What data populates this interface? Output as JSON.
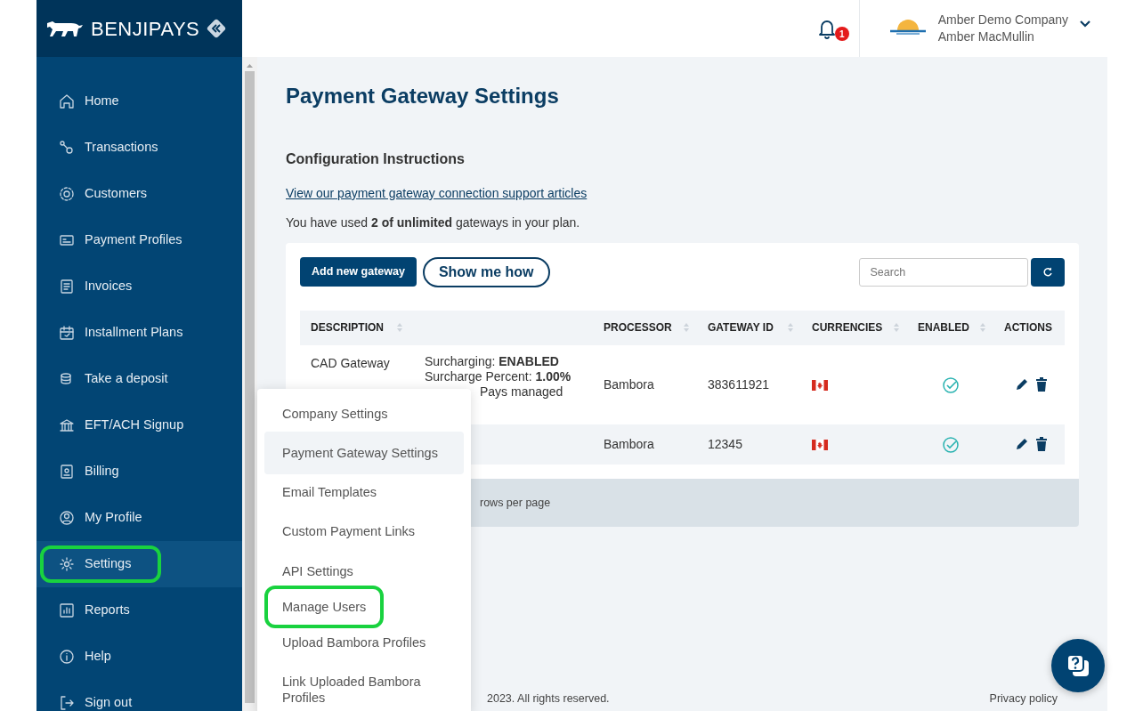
{
  "logo": {
    "text": "**BENJI**PAYS"
  },
  "sidebar": {
    "items": [
      {
        "label": "Home",
        "selected": false,
        "highlighted": false
      },
      {
        "label": "Transactions",
        "selected": false,
        "highlighted": false
      },
      {
        "label": "Customers",
        "selected": false,
        "highlighted": false
      },
      {
        "label": "Payment Profiles",
        "selected": false,
        "highlighted": false
      },
      {
        "label": "Invoices",
        "selected": false,
        "highlighted": false
      },
      {
        "label": "Installment Plans",
        "selected": false,
        "highlighted": false
      },
      {
        "label": "Take a deposit",
        "selected": false,
        "highlighted": false
      },
      {
        "label": "EFT/ACH Signup",
        "selected": false,
        "highlighted": false
      },
      {
        "label": "Billing",
        "selected": false,
        "highlighted": false
      },
      {
        "label": "My Profile",
        "selected": false,
        "highlighted": false
      },
      {
        "label": "Settings",
        "selected": true,
        "highlighted": true
      },
      {
        "label": "Reports",
        "selected": false,
        "highlighted": false
      },
      {
        "label": "Help",
        "selected": false,
        "highlighted": false
      },
      {
        "label": "Sign out",
        "selected": false,
        "highlighted": false
      }
    ]
  },
  "topbar": {
    "notifications": "1",
    "company": "Amber Demo Company",
    "user": "Amber MacMullin"
  },
  "page": {
    "title": "Payment Gateway Settings",
    "section": "Configuration Instructions",
    "link": "View our payment gateway connection support articles",
    "usage": "You have used **2 of unlimited** gateways in your plan."
  },
  "toolbar": {
    "buttons": [
      "Add new gateway",
      "Show me how"
    ],
    "search": {
      "placeholder": "Search"
    }
  },
  "table": {
    "columns": [
      {
        "label": "DESCRIPTION",
        "sortable": true
      },
      {
        "label": "PROCESSOR",
        "sortable": true
      },
      {
        "label": "GATEWAY ID",
        "sortable": true
      },
      {
        "label": "CURRENCIES",
        "sortable": true
      },
      {
        "label": "ENABLED",
        "sortable": true
      },
      {
        "label": "ACTIONS",
        "sortable": false
      }
    ],
    "rows": [
      {
        "description": "CAD Gateway",
        "details": [
          {
            "text": "Surcharging: **ENABLED**",
            "covered": false
          },
          {
            "text": "Surcharge Percent: **1.00%**",
            "covered": false
          },
          {
            "text": "Pays managed",
            "covered": true
          }
        ],
        "processor": "Bambora",
        "gateway_id": "383611921",
        "enabled": true
      },
      {
        "processor": "Bambora",
        "gateway_id": "12345",
        "enabled": true
      }
    ]
  },
  "pagination": {
    "label": "rows per page"
  },
  "dropdown": {
    "items": [
      {
        "label": "Company Settings",
        "selected": false,
        "highlighted": false
      },
      {
        "label": "Payment Gateway Settings",
        "selected": true,
        "highlighted": false
      },
      {
        "label": "Email Templates",
        "selected": false,
        "highlighted": false
      },
      {
        "label": "Custom Payment Links",
        "selected": false,
        "highlighted": false
      },
      {
        "label": "API Settings",
        "selected": false,
        "highlighted": false
      },
      {
        "label": "Manage Users",
        "selected": false,
        "highlighted": true
      },
      {
        "label": "Upload Bambora Profiles",
        "selected": false,
        "highlighted": false
      },
      {
        "label": "Link Uploaded Bambora Profiles",
        "selected": false,
        "highlighted": false
      }
    ]
  },
  "footer": {
    "copyright": "2023. All rights reserved.",
    "privacy": "Privacy policy"
  }
}
